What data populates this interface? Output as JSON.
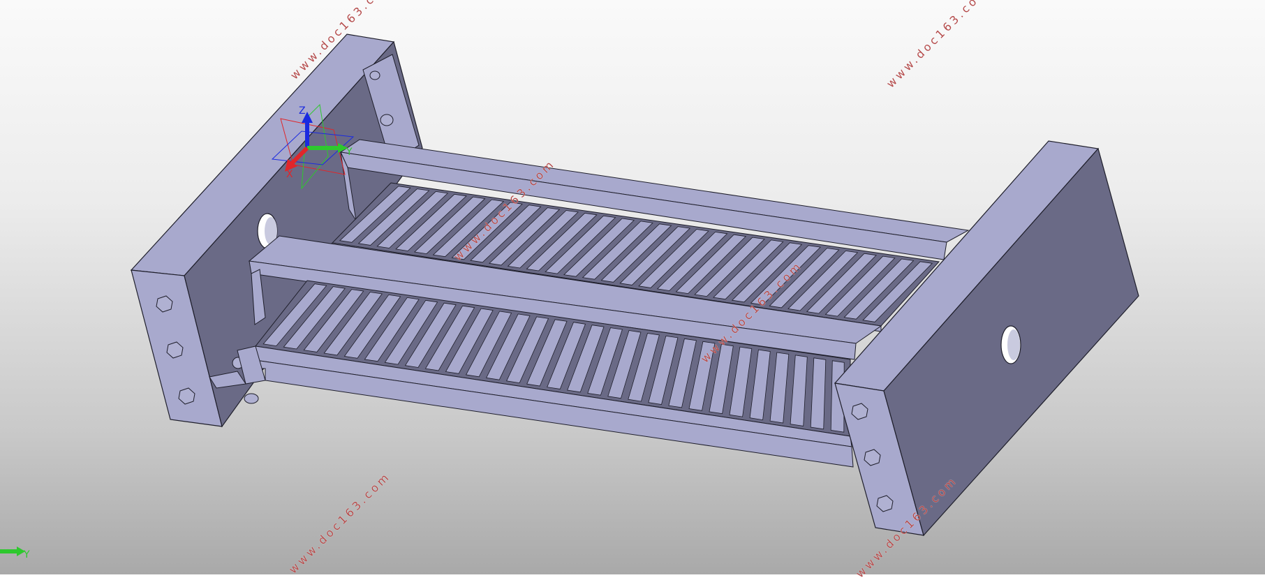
{
  "viewport": {
    "background_top": "#fafafa",
    "background_bottom": "#a9a9a9"
  },
  "model": {
    "face_light": "#a8a9cd",
    "face_dark": "#6a6a86",
    "face_mid": "#8e8fb3",
    "edge": "#1e1e2a",
    "slat_count": 29
  },
  "triad": {
    "z_label": "Z",
    "x_label": "X",
    "y_label": "Y",
    "x_color": "#e0262a",
    "y_color": "#2ec82e",
    "z_color": "#1a2ae0"
  },
  "view_indicator": {
    "label": "Y",
    "color": "#2ec82e"
  },
  "watermarks": [
    "www.doc163.com",
    "www.doc163.com",
    "www.doc163.com",
    "www.doc163.com",
    "www.doc163.com",
    "www.doc163.com",
    "www.doc163.com"
  ]
}
